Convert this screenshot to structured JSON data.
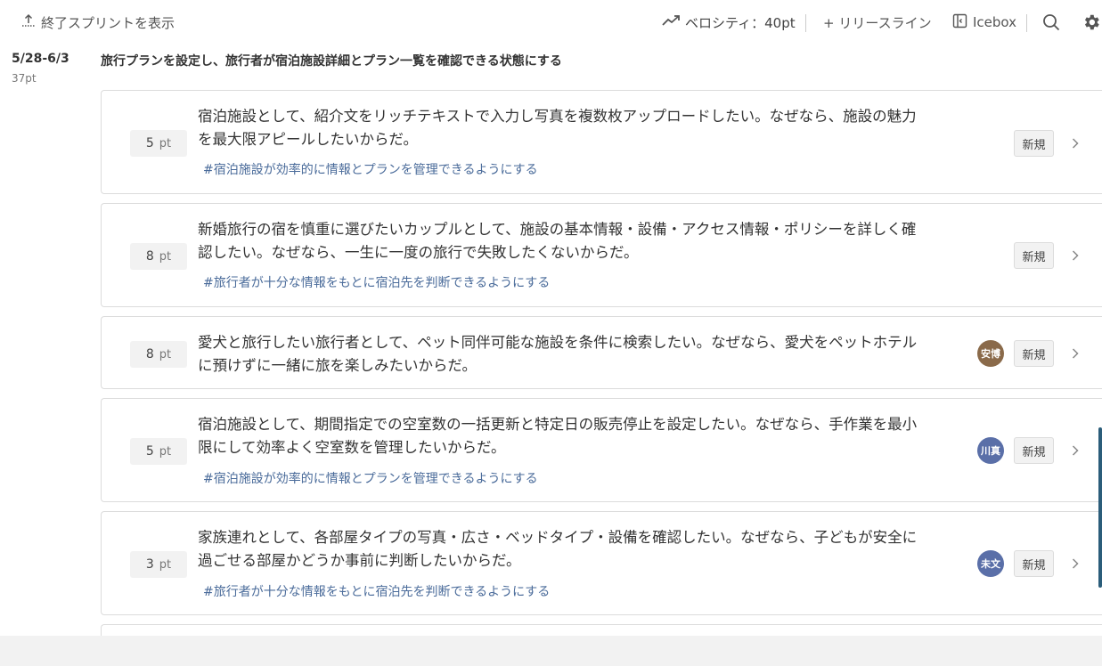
{
  "toolbar": {
    "show_closed_label": "終了スプリントを表示",
    "velocity_label": "ベロシティ：40pt",
    "release_line_label": "+ リリースライン",
    "icebox_label": "Icebox"
  },
  "sprint": {
    "dates": "5/28-6/3",
    "points": "37pt",
    "goal": "旅行プランを設定し、旅行者が宿泊施設詳細とプラン一覧を確認できる状態にする"
  },
  "stories": [
    {
      "points": "5",
      "unit": "pt",
      "line1": "宿泊施設として、紹介文をリッチテキストで入力し写真を複数枚アップロードしたい。なぜなら、施設の魅力",
      "line2": "を最大限アピールしたいからだ。",
      "epic": "#宿泊施設が効率的に情報とプランを管理できるようにする",
      "assignee": "",
      "status": "新規"
    },
    {
      "points": "8",
      "unit": "pt",
      "line1": "新婚旅行の宿を慎重に選びたいカップルとして、施設の基本情報・設備・アクセス情報・ポリシーを詳しく確",
      "line2": "認したい。なぜなら、一生に一度の旅行で失敗したくないからだ。",
      "epic": "#旅行者が十分な情報をもとに宿泊先を判断できるようにする",
      "assignee": "",
      "status": "新規"
    },
    {
      "points": "8",
      "unit": "pt",
      "line1": "愛犬と旅行したい旅行者として、ペット同伴可能な施設を条件に検索したい。なぜなら、愛犬をペットホテル",
      "line2": "に預けずに一緒に旅を楽しみたいからだ。",
      "epic": "",
      "assignee": "安博",
      "status": "新規"
    },
    {
      "points": "5",
      "unit": "pt",
      "line1": "宿泊施設として、期間指定での空室数の一括更新と特定日の販売停止を設定したい。なぜなら、手作業を最小",
      "line2": "限にして効率よく空室数を管理したいからだ。",
      "epic": "#宿泊施設が効率的に情報とプランを管理できるようにする",
      "assignee": "川真",
      "status": "新規"
    },
    {
      "points": "3",
      "unit": "pt",
      "line1": "家族連れとして、各部屋タイプの写真・広さ・ベッドタイプ・設備を確認したい。なぜなら、子どもが安全に",
      "line2": "過ごせる部屋かどうか事前に判断したいからだ。",
      "epic": "#旅行者が十分な情報をもとに宿泊先を判断できるようにする",
      "assignee": "未文",
      "status": "新規"
    }
  ],
  "colors": {
    "avatar_1": "#8a6a4a",
    "avatar_2": "#5a6fa8",
    "avatar_3": "#5a6fa8",
    "epic_link": "#4a6b9a",
    "scroll_thumb": "#2b5d7a"
  }
}
